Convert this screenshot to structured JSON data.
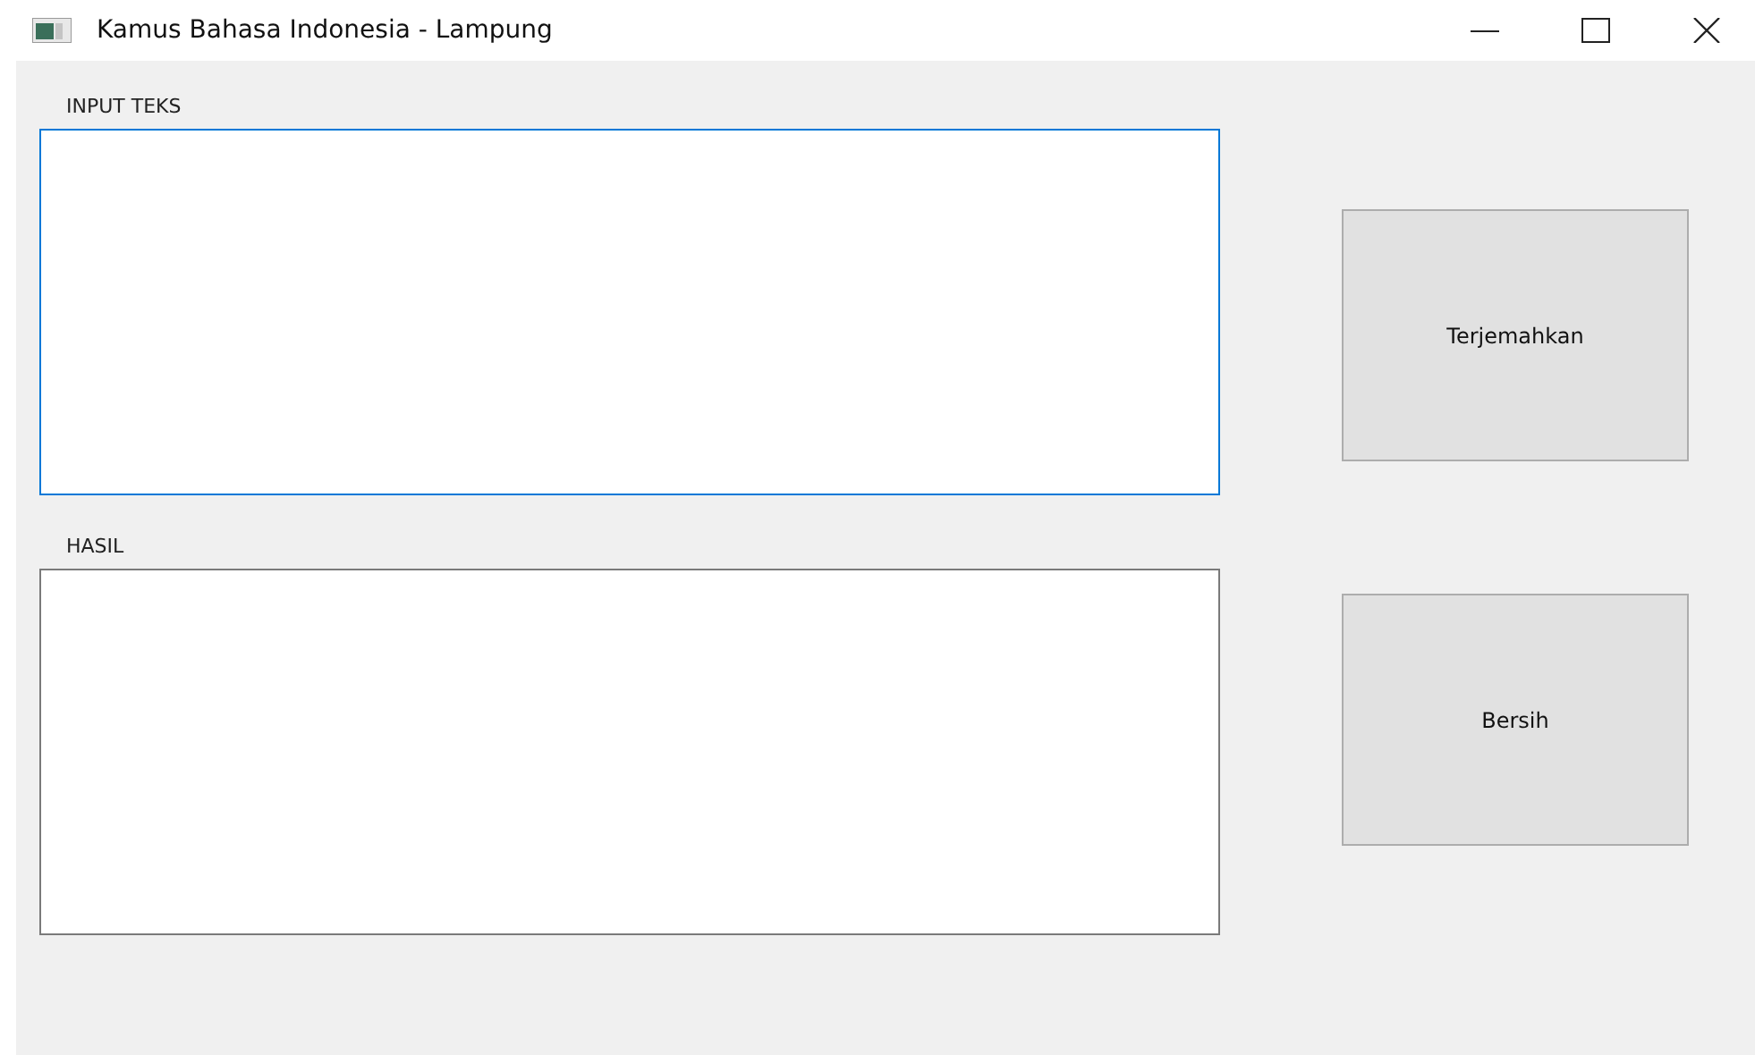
{
  "window": {
    "title": "Kamus Bahasa Indonesia - Lampung"
  },
  "fields": [
    {
      "label": "INPUT TEKS",
      "focused": true
    },
    {
      "label": "HASIL",
      "focused": false
    }
  ],
  "buttons": [
    {
      "label": "Terjemahkan"
    },
    {
      "label": "Bersih"
    }
  ]
}
